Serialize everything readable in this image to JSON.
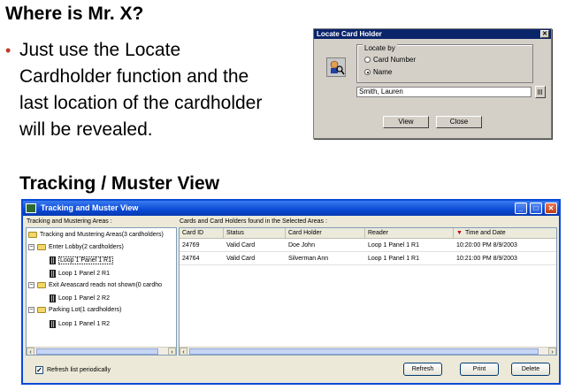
{
  "slide": {
    "title": "Where is Mr. X?",
    "bullet_marker": "•",
    "bullet_lines": [
      "Just use the Locate",
      "Cardholder function and the",
      "last location of the cardholder",
      "will be revealed."
    ],
    "section_title": "Tracking / Muster View"
  },
  "locate_dialog": {
    "title": "Locate Card Holder",
    "close_glyph": "✕",
    "group_label": "Locate by",
    "options": [
      {
        "label": "Card Number",
        "selected": false
      },
      {
        "label": "Name",
        "selected": true
      }
    ],
    "name_value": "Smith, Lauren",
    "buttons": {
      "view": "View",
      "close": "Close"
    }
  },
  "tracking_window": {
    "title": "Tracking and Muster View",
    "controls": {
      "minimize": "_",
      "maximize": "□",
      "close": "✕"
    },
    "left_pane_label": "Tracking and Mustering Areas :",
    "right_pane_label": "Cards and Card Holders found in the Selected Areas :",
    "tree": [
      {
        "label": "Tracking and Mustering Areas(3 cardholders)",
        "type": "folder",
        "level": 0,
        "expander": ""
      },
      {
        "label": "Enter Lobby(2 cardholders)",
        "type": "folder",
        "level": 1,
        "expander": "−"
      },
      {
        "label": "Loop 1 Panel 1 R1",
        "type": "reader",
        "level": 2,
        "expander": "",
        "selected": true
      },
      {
        "label": "Loop 1 Panel 2 R1",
        "type": "reader",
        "level": 2,
        "expander": ""
      },
      {
        "label": "Exit Areascard reads not shown(0 cardho",
        "type": "folder",
        "level": 1,
        "expander": "−"
      },
      {
        "label": "Loop 1 Panel 2 R2",
        "type": "reader",
        "level": 2,
        "expander": ""
      },
      {
        "label": "Parking Lot(1 cardholders)",
        "type": "folder",
        "level": 1,
        "expander": "−"
      },
      {
        "label": "Loop 1 Panel 1 R2",
        "type": "reader",
        "level": 2,
        "expander": ""
      }
    ],
    "table": {
      "sort_marker": "▼",
      "columns": [
        "Card ID",
        "Status",
        "Card Holder",
        "Reader",
        "Time and Date"
      ],
      "rows": [
        [
          "24769",
          "Valid Card",
          "Doe John",
          "Loop 1 Panel 1 R1",
          "10:20:00 PM 8/9/2003"
        ],
        [
          "24764",
          "Valid Card",
          "Silverman Ann",
          "Loop 1 Panel 1 R1",
          "10:21:00 PM 8/9/2003"
        ]
      ]
    },
    "scroll_arrows": {
      "left": "‹",
      "right": "›"
    },
    "refresh_checkbox": {
      "label": "Refresh list periodically",
      "checked": true,
      "mark": "✓"
    },
    "buttons": {
      "refresh": "Refresh",
      "print": "Print",
      "delete": "Delete"
    }
  }
}
